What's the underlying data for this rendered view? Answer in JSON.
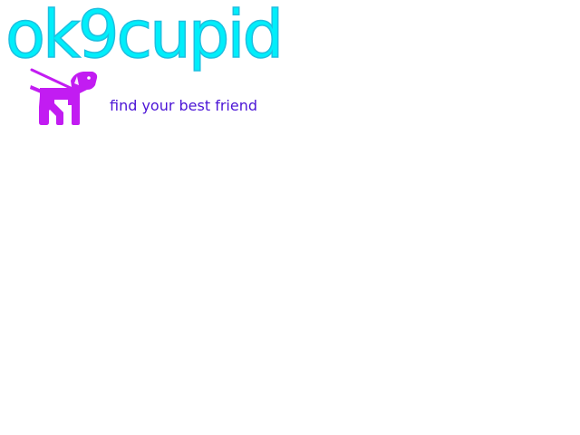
{
  "brand": {
    "name": "ok9cupid",
    "tagline": "find your best friend",
    "icon": "dog-on-leash-icon",
    "colors": {
      "logo_text": "#00eefa",
      "logo_outline": "#1fbfe0",
      "dog": "#c21cf2",
      "tagline": "#4b14d6",
      "background": "#ffffff"
    }
  }
}
